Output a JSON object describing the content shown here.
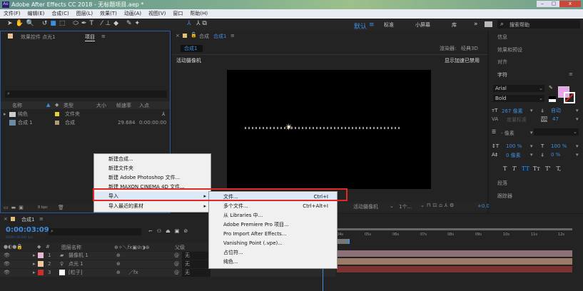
{
  "window": {
    "title": "Adobe After Effects CC 2018 - 无标题项目.aep *",
    "controls": [
      "–",
      "▢",
      "x"
    ]
  },
  "menu": [
    "文件(F)",
    "编辑(E)",
    "合成(C)",
    "图层(L)",
    "效果(T)",
    "动画(A)",
    "视图(V)",
    "窗口",
    "帮助(H)"
  ],
  "workspaces": {
    "items": [
      "默认",
      "标准",
      "小屏幕",
      "库"
    ],
    "active": "默认",
    "more": "»",
    "search_placeholder": "搜索帮助"
  },
  "project": {
    "tab_effects": "效果控件 点光1",
    "tab_project": "项目",
    "columns": [
      "名称",
      "类型",
      "大小",
      "帧速率",
      "入点"
    ],
    "rows": [
      {
        "name": "纯色",
        "type": "文件夹",
        "fps": "",
        "in": "",
        "color": "#e6d23a"
      },
      {
        "name": "合成 1",
        "type": "合成",
        "fps": "29.684",
        "in": "0:00:00:00",
        "color": "#b39b74"
      }
    ],
    "bpc": "8 bpc"
  },
  "comp": {
    "tab": "合成",
    "tab_name": "合成1",
    "subtab": "合成1",
    "renderer_label": "渲染器:",
    "renderer": "经典3D",
    "camera": "活动摄像机",
    "accel": "显示加速已禁用",
    "toolbar_camera": "活动摄像机",
    "toolbar_views": "1个...",
    "exposure": "+0.0"
  },
  "right": {
    "panels": [
      "信息",
      "效果和预设",
      "对齐",
      "字符",
      "段落",
      "跟踪器"
    ],
    "character": {
      "font": "Arial",
      "style": "Bold",
      "size": "267 像素",
      "leading": "自动",
      "kerning": "度量标准",
      "tracking": "47",
      "stroke": "- 像素",
      "vscale": "100 %",
      "hscale": "100 %",
      "baseline": "0 像素",
      "tsume": "0 %",
      "fill_color": "#e8a6ea",
      "styles": [
        "T",
        "T",
        "TT",
        "Tт",
        "T'",
        "T,"
      ]
    }
  },
  "context_menu": {
    "items": [
      "新建合成...",
      "新建文件夹",
      "新建 Adobe Photoshop 文件...",
      "新建 MAXON CINEMA 4D 文件...",
      "导入",
      "导入最近的素材"
    ],
    "highlight": "导入"
  },
  "submenu": {
    "items": [
      {
        "label": "文件...",
        "shortcut": "Ctrl+I"
      },
      {
        "label": "多个文件...",
        "shortcut": "Ctrl+Alt+I"
      },
      {
        "label": "从 Libraries 中..."
      },
      {
        "label": "Adobe Premiere Pro 项目..."
      },
      {
        "label": "Pro Import After Effects..."
      },
      {
        "label": "Vanishing Point (.vpe)..."
      },
      {
        "label": "占位符..."
      },
      {
        "label": "纯色..."
      }
    ]
  },
  "timeline": {
    "tab": "合成1",
    "timecode": "0:00:03:09",
    "frames": "00099 (29.684 fps)",
    "col_num": "#",
    "col_name": "图层名称",
    "col_parent": "父级",
    "ruler": [
      "04s",
      "05s",
      "06s",
      "07s",
      "08s",
      "09s",
      "10s",
      "11s",
      "12s"
    ],
    "layers": [
      {
        "num": "1",
        "name": "摄像机 1",
        "color": "#e8b7cf",
        "parent": "无",
        "bar": "#8d7078"
      },
      {
        "num": "2",
        "name": "点光 1",
        "color": "#f0c79c",
        "parent": "无",
        "bar": "#9b7b67"
      },
      {
        "num": "3",
        "name": "[粒子]",
        "color": "#c83030",
        "parent": "无",
        "bar": "#7b3230"
      }
    ]
  }
}
